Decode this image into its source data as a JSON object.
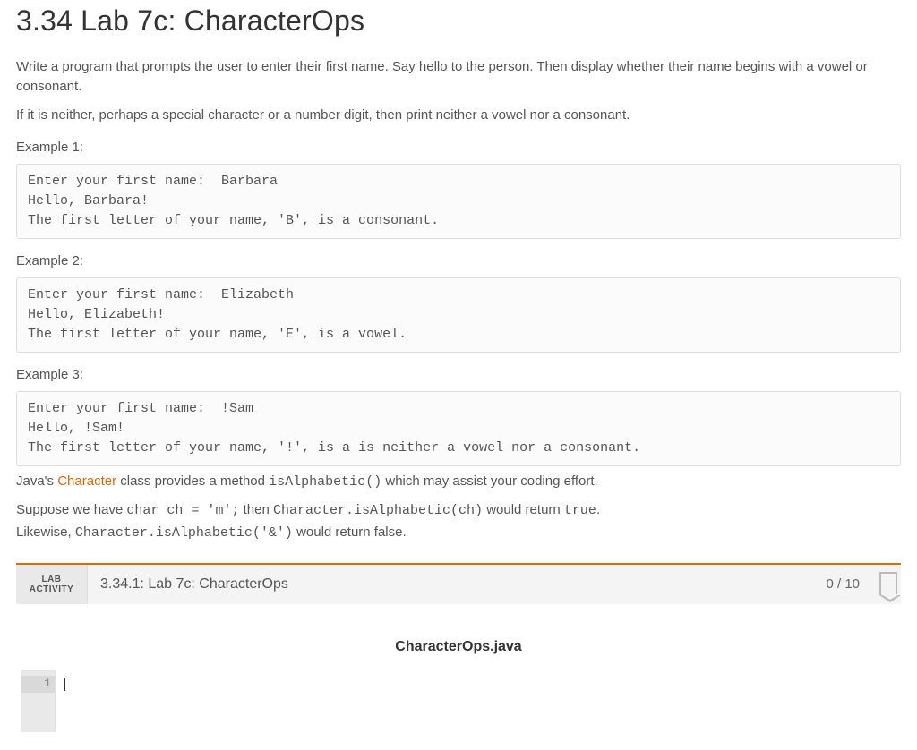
{
  "heading": "3.34 Lab 7c: CharacterOps",
  "intro": {
    "p1": "Write a program that prompts the user to enter their first name. Say hello to the person. Then display whether their name begins with a vowel or consonant.",
    "p2": "If it is neither, perhaps a special character or a number digit, then print neither a vowel nor a consonant."
  },
  "examples": [
    {
      "label": "Example 1:",
      "code": "Enter your first name:  Barbara\nHello, Barbara!\nThe first letter of your name, 'B', is a consonant."
    },
    {
      "label": "Example 2:",
      "code": "Enter your first name:  Elizabeth\nHello, Elizabeth!\nThe first letter of your name, 'E', is a vowel."
    },
    {
      "label": "Example 3:",
      "code": "Enter your first name:  !Sam\nHello, !Sam!\nThe first letter of your name, '!', is a is neither a vowel nor a consonant."
    }
  ],
  "hint": {
    "part1": "Java's ",
    "linkText": "Character",
    "part2": " class provides a method ",
    "code1": "isAlphabetic()",
    "part3": " which may assist your coding effort."
  },
  "suppose": {
    "p1a": "Suppose we have ",
    "c1": "char ch = 'm';",
    "p1b": " then ",
    "c2": "Character.isAlphabetic(ch)",
    "p1c": " would return ",
    "c3": "true",
    "p1d": ".",
    "p2a": "Likewise, ",
    "c4": "Character.isAlphabetic('&')",
    "p2b": " would return false."
  },
  "lab": {
    "badgeTop": "LAB",
    "badgeBottom": "ACTIVITY",
    "title": "3.34.1: Lab 7c: CharacterOps",
    "score": "0 / 10"
  },
  "editor": {
    "filename": "CharacterOps.java",
    "lineNumber": "1"
  }
}
